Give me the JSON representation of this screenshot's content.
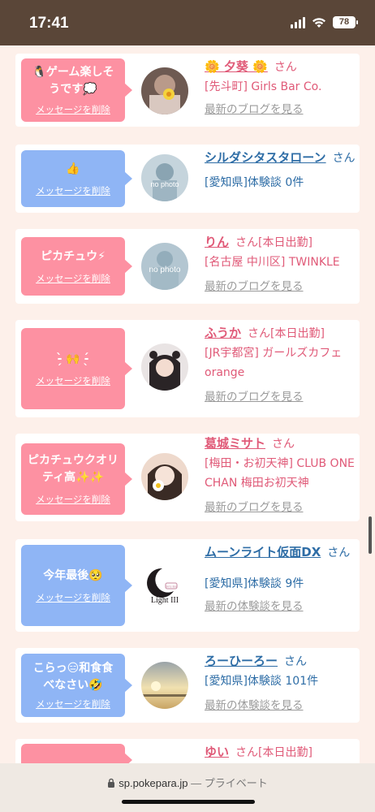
{
  "status_bar": {
    "time": "17:41",
    "battery": "78"
  },
  "cards": [
    {
      "message": "🐧ゲーム楽しそうです💭",
      "delete_label": "メッセージを削除",
      "bubble_color": "#fd91a2",
      "name": "🌼 夕葵 🌼",
      "san": "さん",
      "today": "",
      "shop": "[先斗町] Girls Bar Co.",
      "link": "最新のブログを見る"
    },
    {
      "message": "👍",
      "delete_label": "メッセージを削除",
      "bubble_color": "#8fb5f5",
      "name": "シルダシタスタローン",
      "san": "さん",
      "today": "",
      "shop": "[愛知県]体験談 0件",
      "link": ""
    },
    {
      "message": "ピカチュウ⚡",
      "delete_label": "メッセージを削除",
      "bubble_color": "#fd91a2",
      "name": "りん",
      "san": "さん",
      "today": "[本日出勤]",
      "shop": "[名古屋 中川区] TWINKLE",
      "link": "最新のブログを見る"
    },
    {
      "message": "-̗̀ 🙌 -̖́",
      "delete_label": "メッセージを削除",
      "bubble_color": "#fd91a2",
      "name": "ふうか",
      "san": "さん",
      "today": "[本日出勤]",
      "shop": "[JR宇都宮] ガールズカフェ orange",
      "link": "最新のブログを見る"
    },
    {
      "message": "ピカチュウクオリティ高✨✨",
      "delete_label": "メッセージを削除",
      "bubble_color": "#fd91a2",
      "name": "葛城ミサト",
      "san": "さん",
      "today": "",
      "shop": "[梅田・お初天神] CLUB ONE CHAN 梅田お初天神",
      "link": "最新のブログを見る"
    },
    {
      "message": "今年最後🥺",
      "delete_label": "メッセージを削除",
      "bubble_color": "#8fb5f5",
      "name": "ムーンライト仮面DX",
      "san": "さん",
      "today": "",
      "shop": "[愛知県]体験談 9件",
      "link": "最新の体験談を見る"
    },
    {
      "message": "こらっ😑和食食べなさい🤣",
      "delete_label": "メッセージを削除",
      "bubble_color": "#8fb5f5",
      "name": "ろーひーろー",
      "san": "さん",
      "today": "",
      "shop": "[愛知県]体験談 101件",
      "link": "最新の体験談を見る"
    },
    {
      "message": "",
      "delete_label": "",
      "bubble_color": "#fd91a2",
      "name": "ゆい",
      "san": "さん",
      "today": "[本日出勤]",
      "shop": "",
      "link": ""
    }
  ],
  "avatar_texts": {
    "no_photo": "no photo",
    "logo_small": "Girls Bar",
    "logo_main": "Light III"
  },
  "browser": {
    "url": "sp.pokepara.jp",
    "private": "— プライベート"
  }
}
